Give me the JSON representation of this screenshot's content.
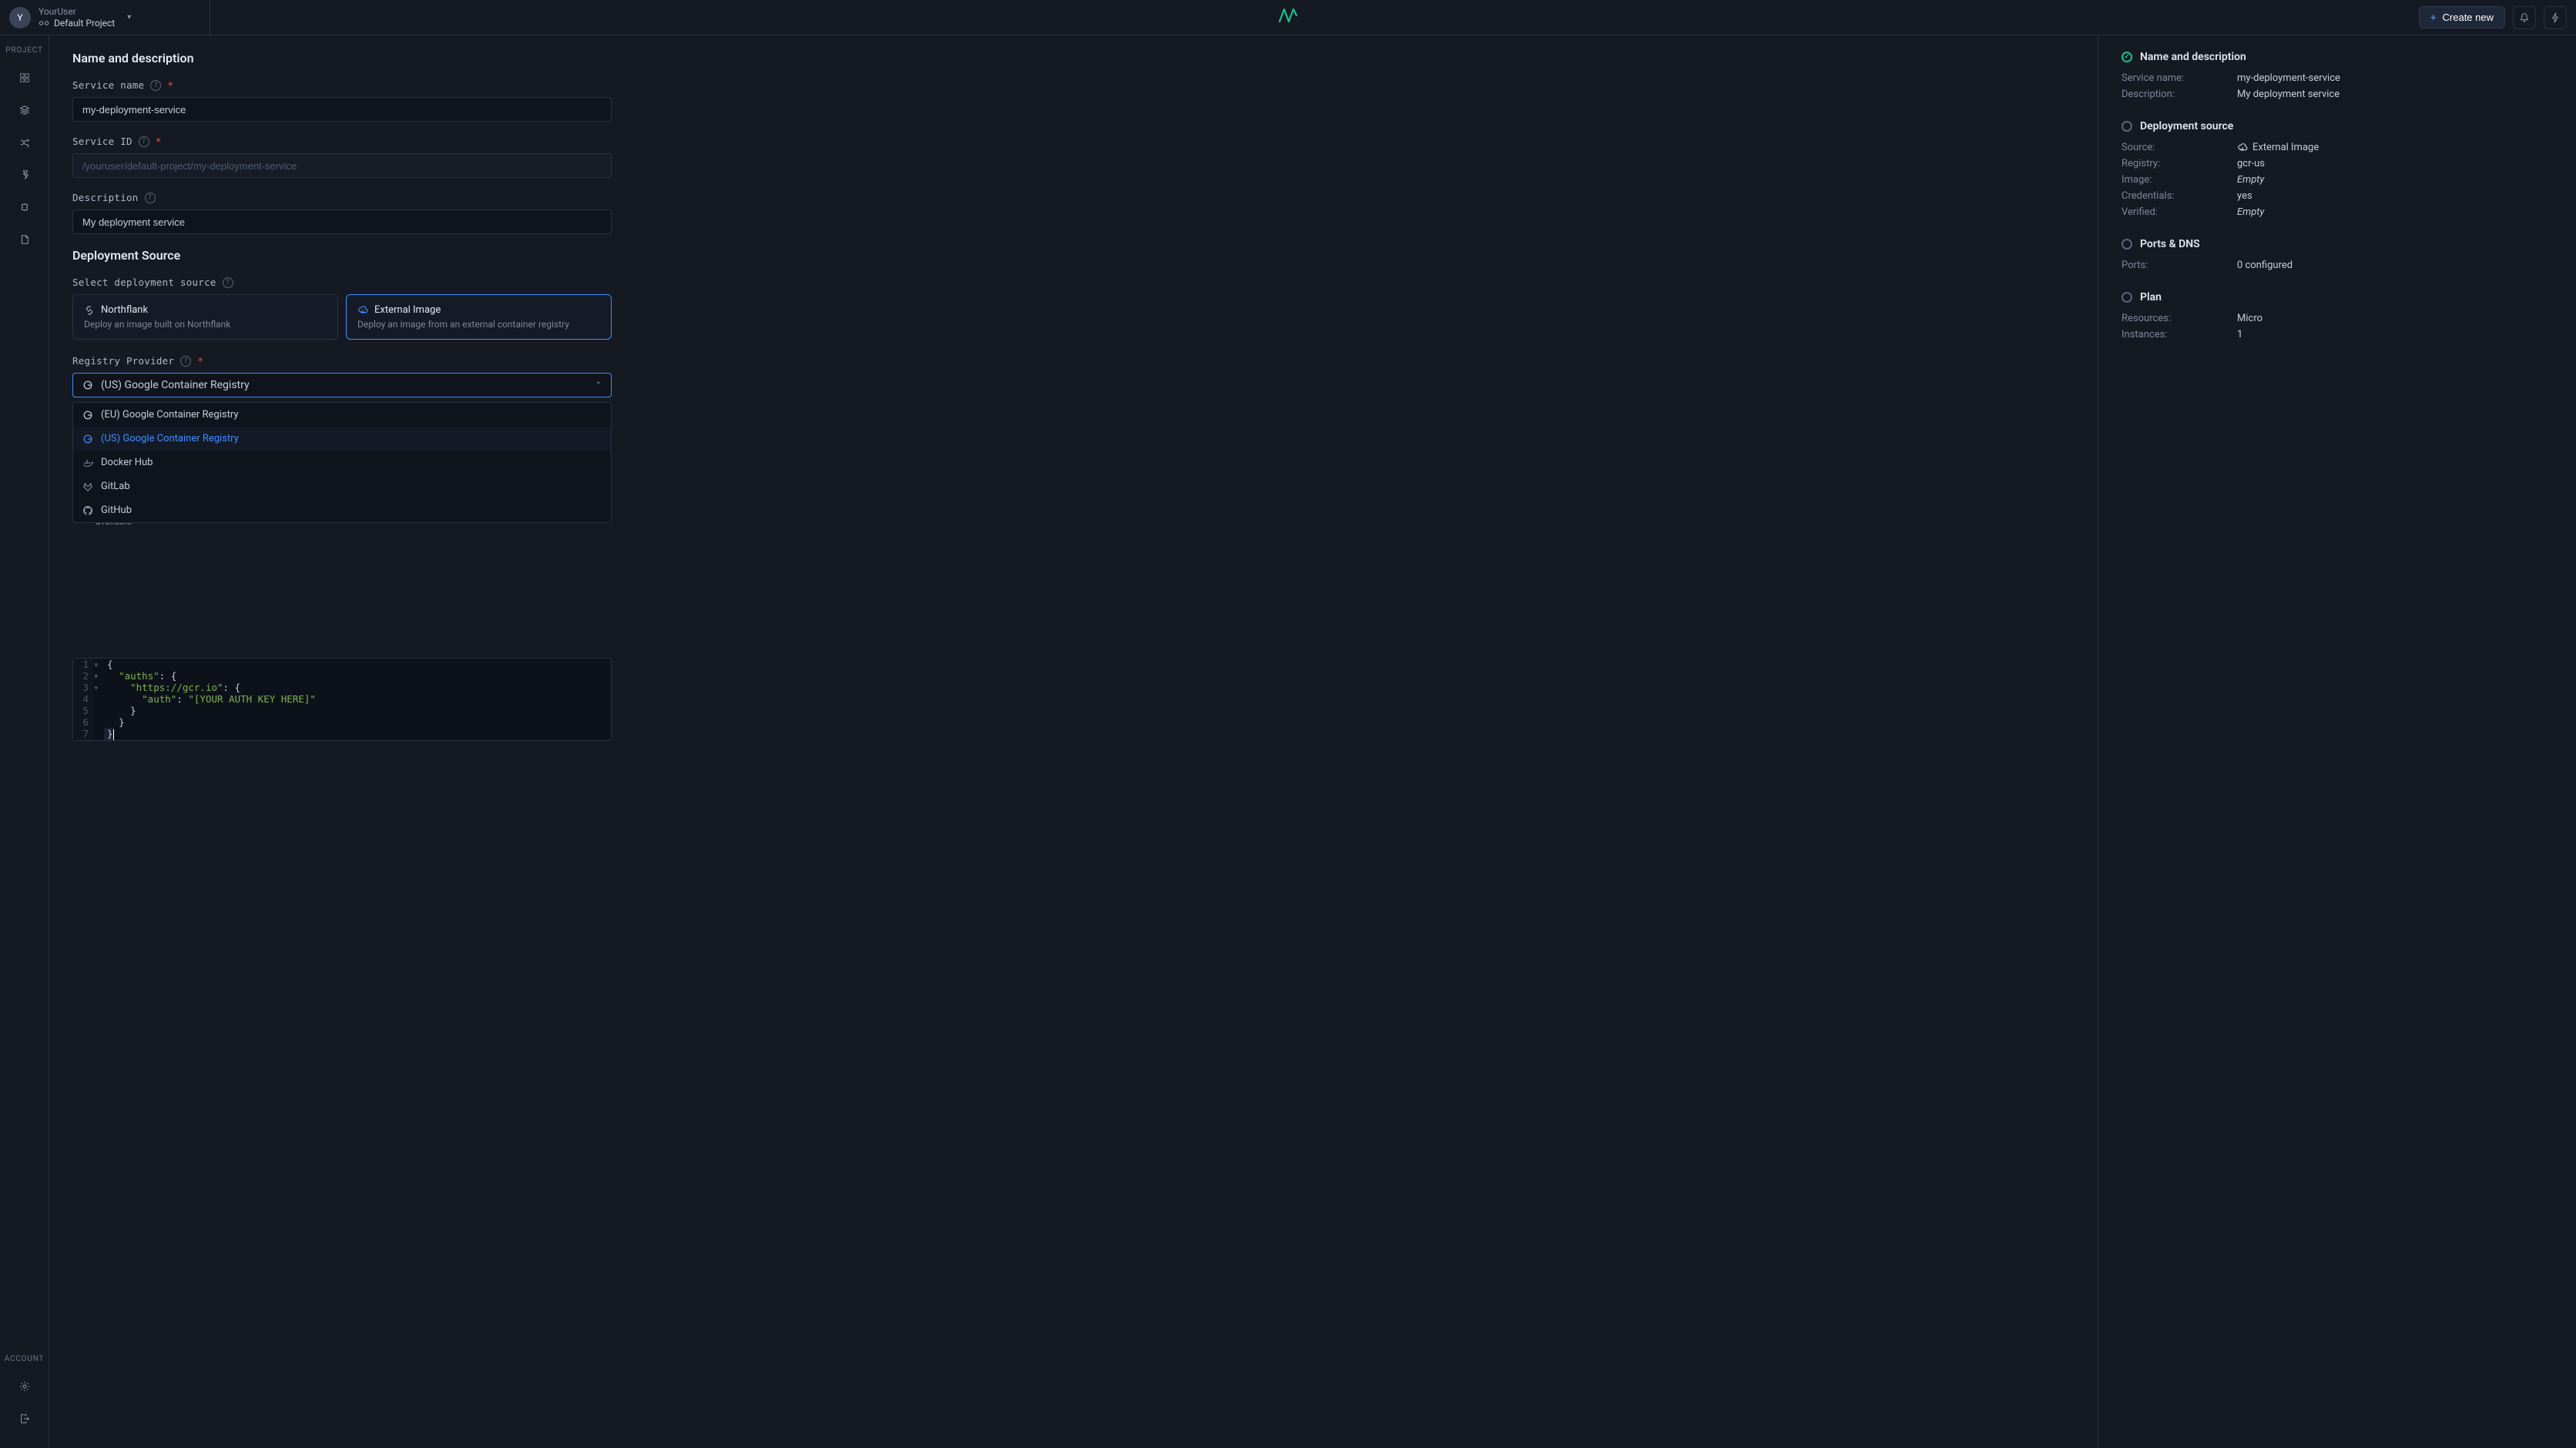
{
  "topbar": {
    "avatar_initial": "Y",
    "username": "YourUser",
    "project_label": "Default Project",
    "create_label": "Create new"
  },
  "leftnav": {
    "project_label": "Project",
    "account_label": "Account"
  },
  "form": {
    "section_name_desc": "Name and description",
    "service_name_label": "Service name",
    "service_name_value": "my-deployment-service",
    "service_id_label": "Service ID",
    "service_id_value": "/youruser/default-project/my-deployment-service",
    "description_label": "Description",
    "description_value": "My deployment service",
    "section_source": "Deployment Source",
    "select_source_label": "Select deployment source",
    "source_options": [
      {
        "title": "Northflank",
        "desc": "Deploy an image built on Northflank"
      },
      {
        "title": "External Image",
        "desc": "Deploy an image from an external container registry"
      }
    ],
    "registry_provider_label": "Registry Provider",
    "registry_selected": "(US) Google Container Registry",
    "registry_options": [
      "(EU) Google Container Registry",
      "(US) Google Container Registry",
      "Docker Hub",
      "GitLab",
      "GitHub"
    ],
    "availability_note": "available",
    "code_lines": [
      "{",
      "  \"auths\": {",
      "    \"https://gcr.io\": {",
      "      \"auth\": \"[YOUR AUTH KEY HERE]\"",
      "    }",
      "  }",
      "}"
    ]
  },
  "summary": {
    "sections": {
      "name_desc": {
        "title": "Name and description",
        "rows": [
          {
            "k": "Service name:",
            "v": "my-deployment-service"
          },
          {
            "k": "Description:",
            "v": "My deployment service"
          }
        ]
      },
      "deploy_source": {
        "title": "Deployment source",
        "rows": [
          {
            "k": "Source:",
            "v": "External Image",
            "icon": true
          },
          {
            "k": "Registry:",
            "v": "gcr-us"
          },
          {
            "k": "Image:",
            "v": "Empty",
            "empty": true
          },
          {
            "k": "Credentials:",
            "v": "yes"
          },
          {
            "k": "Verified:",
            "v": "Empty",
            "empty": true
          }
        ]
      },
      "ports": {
        "title": "Ports & DNS",
        "rows": [
          {
            "k": "Ports:",
            "v": "0 configured"
          }
        ]
      },
      "plan": {
        "title": "Plan",
        "rows": [
          {
            "k": "Resources:",
            "v": "Micro"
          },
          {
            "k": "Instances:",
            "v": "1"
          }
        ]
      }
    }
  }
}
